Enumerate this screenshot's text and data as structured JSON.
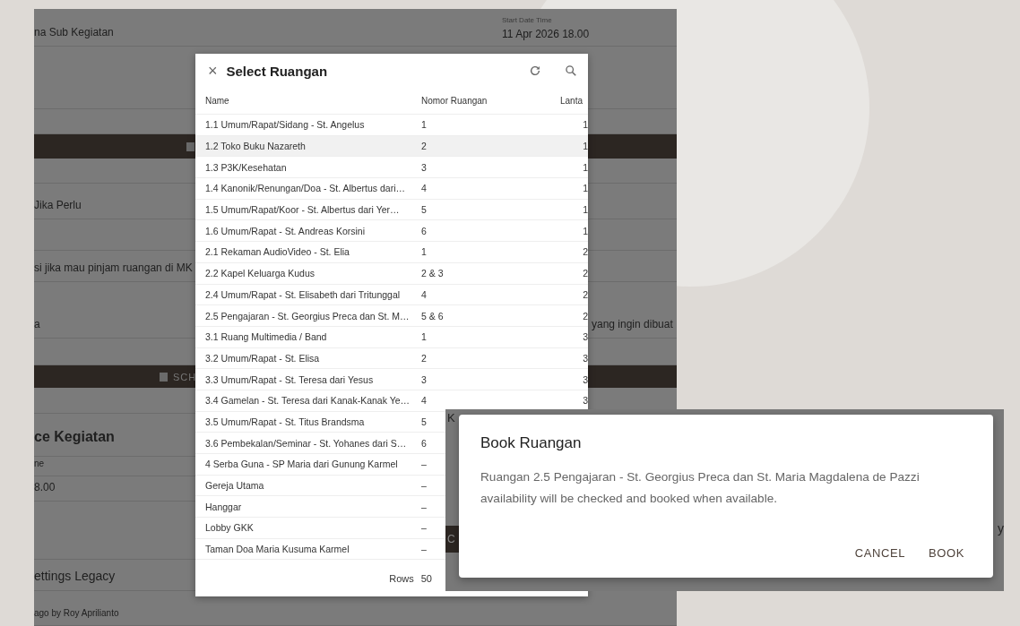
{
  "background_page": {
    "rows": [
      {
        "kind": "field",
        "text": "na Sub Kegiatan",
        "side_label": "Start Date Time",
        "side_value": "11 Apr 2026 18.00"
      },
      {
        "kind": "blank"
      },
      {
        "kind": "blank"
      },
      {
        "kind": "bar"
      },
      {
        "kind": "blank"
      },
      {
        "kind": "field",
        "text": "Jika Perlu"
      },
      {
        "kind": "blank"
      },
      {
        "kind": "field",
        "text": "si jika mau pinjam ruangan di MK"
      },
      {
        "kind": "field",
        "text": "a",
        "side_value": "yang ingin dibuat"
      },
      {
        "kind": "blank"
      },
      {
        "kind": "bar",
        "text": "SCH"
      },
      {
        "kind": "blank"
      },
      {
        "kind": "heading",
        "text": "ce Kegiatan"
      },
      {
        "kind": "label",
        "text": "ne"
      },
      {
        "kind": "field",
        "text": "8.00"
      },
      {
        "kind": "blank"
      },
      {
        "kind": "title",
        "text": "ettings Legacy"
      },
      {
        "kind": "label",
        "text": "ago by Roy Aprilianto"
      }
    ],
    "lower_panel": {
      "top_text": "K",
      "bar_text": "C",
      "side_text": "y"
    }
  },
  "select_dialog": {
    "title": "Select Ruangan",
    "close": "×",
    "columns": [
      "Name",
      "Nomor Ruangan",
      "Lanta"
    ],
    "rows": [
      {
        "name": "1.1 Umum/Rapat/Sidang - St. Angelus",
        "nomor": "1",
        "lantai": "1",
        "selected": false
      },
      {
        "name": "1.2 Toko Buku Nazareth",
        "nomor": "2",
        "lantai": "1",
        "selected": true
      },
      {
        "name": "1.3 P3K/Kesehatan",
        "nomor": "3",
        "lantai": "1",
        "selected": false
      },
      {
        "name": "1.4 Kanonik/Renungan/Doa - St. Albertus dari…",
        "nomor": "4",
        "lantai": "1",
        "selected": false
      },
      {
        "name": "1.5 Umum/Rapat/Koor - St. Albertus dari Yer…",
        "nomor": "5",
        "lantai": "1",
        "selected": false
      },
      {
        "name": "1.6 Umum/Rapat - St. Andreas Korsini",
        "nomor": "6",
        "lantai": "1",
        "selected": false
      },
      {
        "name": "2.1 Rekaman AudioVideo - St. Elia",
        "nomor": "1",
        "lantai": "2",
        "selected": false
      },
      {
        "name": "2.2 Kapel Keluarga Kudus",
        "nomor": "2 & 3",
        "lantai": "2",
        "selected": false
      },
      {
        "name": "2.4 Umum/Rapat - St. Elisabeth dari Tritunggal",
        "nomor": "4",
        "lantai": "2",
        "selected": false
      },
      {
        "name": "2.5 Pengajaran - St. Georgius Preca dan St. M…",
        "nomor": "5 & 6",
        "lantai": "2",
        "selected": false
      },
      {
        "name": "3.1 Ruang Multimedia / Band",
        "nomor": "1",
        "lantai": "3",
        "selected": false
      },
      {
        "name": "3.2 Umum/Rapat - St. Elisa",
        "nomor": "2",
        "lantai": "3",
        "selected": false
      },
      {
        "name": "3.3 Umum/Rapat - St. Teresa dari Yesus",
        "nomor": "3",
        "lantai": "3",
        "selected": false
      },
      {
        "name": "3.4 Gamelan - St. Teresa dari Kanak-Kanak Ye…",
        "nomor": "4",
        "lantai": "3",
        "selected": false
      },
      {
        "name": "3.5 Umum/Rapat - St. Titus Brandsma",
        "nomor": "5",
        "selected": false
      },
      {
        "name": "3.6 Pembekalan/Seminar - St. Yohanes dari S…",
        "nomor": "6",
        "selected": false
      },
      {
        "name": "4 Serba Guna - SP Maria dari Gunung Karmel",
        "nomor": "–",
        "selected": false
      },
      {
        "name": "Gereja Utama",
        "nomor": "–",
        "selected": false
      },
      {
        "name": "Hanggar",
        "nomor": "–",
        "selected": false
      },
      {
        "name": "Lobby GKK",
        "nomor": "–",
        "selected": false
      },
      {
        "name": "Taman Doa Maria Kusuma Karmel",
        "nomor": "–",
        "selected": false
      }
    ],
    "footer": {
      "rows_label": "Rows",
      "rows_value": "50"
    }
  },
  "book_dialog": {
    "title": "Book Ruangan",
    "message": "Ruangan 2.5 Pengajaran - St. Georgius Preca dan St. Maria Magdalena de Pazzi availability will be checked and booked when available.",
    "buttons": [
      "CANCEL",
      "BOOK"
    ]
  }
}
